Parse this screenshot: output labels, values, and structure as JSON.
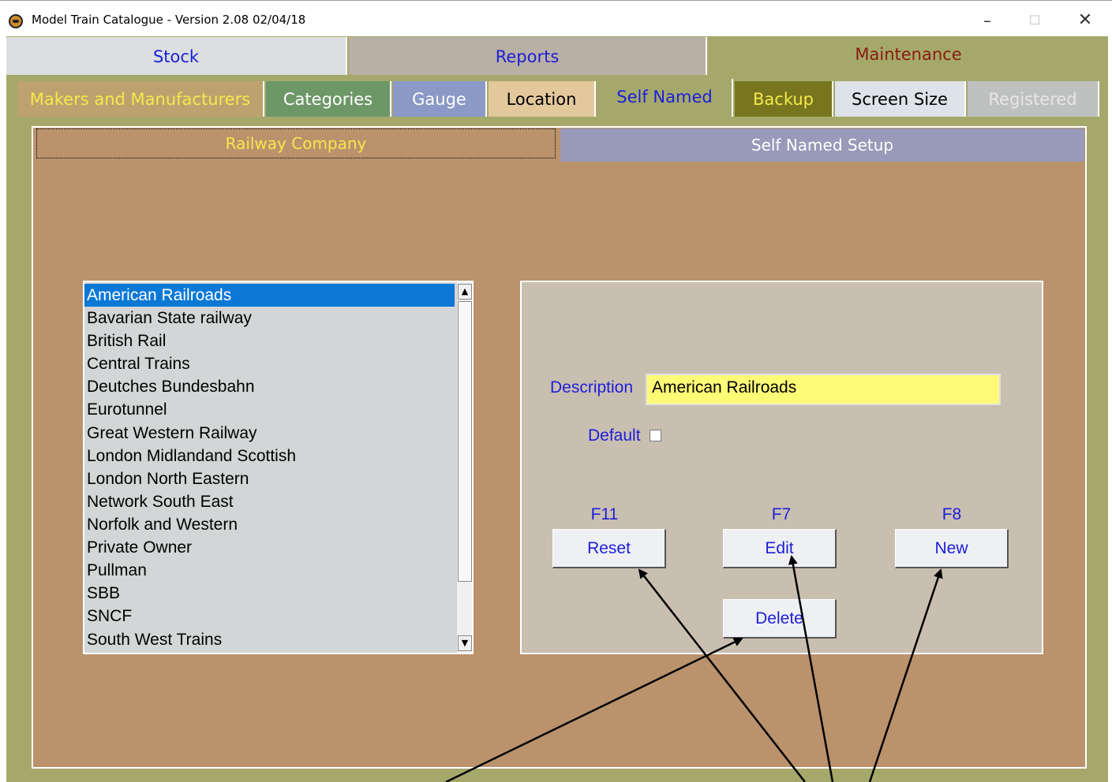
{
  "window": {
    "title": "Model Train Catalogue -  Version 2.08  02/04/18",
    "minimize_glyph": "–",
    "maximize_glyph": "☐",
    "close_glyph": "✕"
  },
  "top_tabs": [
    "Stock",
    "Reports",
    "Maintenance"
  ],
  "sub_tabs": [
    "Makers and Manufacturers",
    "Categories",
    "Gauge",
    "Location",
    "Self Named",
    "Backup",
    "Screen Size",
    "Registered"
  ],
  "inner_tabs": [
    "Railway Company",
    "Self Named Setup"
  ],
  "list": {
    "selected": "American Railroads",
    "items": [
      "American Railroads",
      "Bavarian State railway",
      "British Rail",
      "Central Trains",
      "Deutches Bundesbahn",
      "Eurotunnel",
      "Great Western Railway",
      "London Midlandand Scottish",
      "London North Eastern",
      "Network South East",
      "Norfolk and Western",
      "Private Owner",
      "Pullman",
      "SBB",
      "SNCF",
      "South West Trains"
    ]
  },
  "scroll_arrows": {
    "up": "▲",
    "down": "▼"
  },
  "detail": {
    "description_label": "Description",
    "description_value": "American Railroads",
    "default_label": "Default",
    "default_checked": false,
    "fkeys": {
      "reset": "F11",
      "edit": "F7",
      "new": "F8"
    },
    "buttons": {
      "reset": "Reset",
      "edit": "Edit",
      "new": "New",
      "delete": "Delete"
    }
  },
  "colors": {
    "frame": "#a4a96b",
    "content": "#ba926c",
    "label_blue": "#1d1dd8",
    "selection": "#0b78d6",
    "input_bg": "#fffb77"
  }
}
